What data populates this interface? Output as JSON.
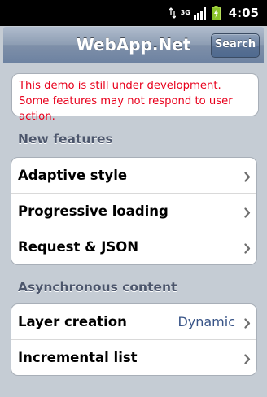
{
  "status_bar": {
    "time": "4:05",
    "network_label": "3G",
    "icons": [
      "data-transfer-icon",
      "network-3g-icon",
      "signal-icon",
      "battery-charging-icon"
    ]
  },
  "header": {
    "title": "WebApp.Net",
    "search_label": "Search"
  },
  "notice": {
    "text": "This demo is still under development. Some features may not respond to user action."
  },
  "sections": [
    {
      "title": "New features",
      "items": [
        {
          "label": "Adaptive style",
          "value": ""
        },
        {
          "label": "Progressive loading",
          "value": ""
        },
        {
          "label": "Request & JSON",
          "value": ""
        }
      ]
    },
    {
      "title": "Asynchronous content",
      "items": [
        {
          "label": "Layer creation",
          "value": "Dynamic"
        },
        {
          "label": "Incremental list",
          "value": ""
        }
      ]
    }
  ],
  "colors": {
    "background": "#c5ccd4",
    "title_bar": "#6d82a1",
    "notice_text": "#e8001c",
    "section_title": "#4c566c",
    "row_value": "#385487"
  }
}
